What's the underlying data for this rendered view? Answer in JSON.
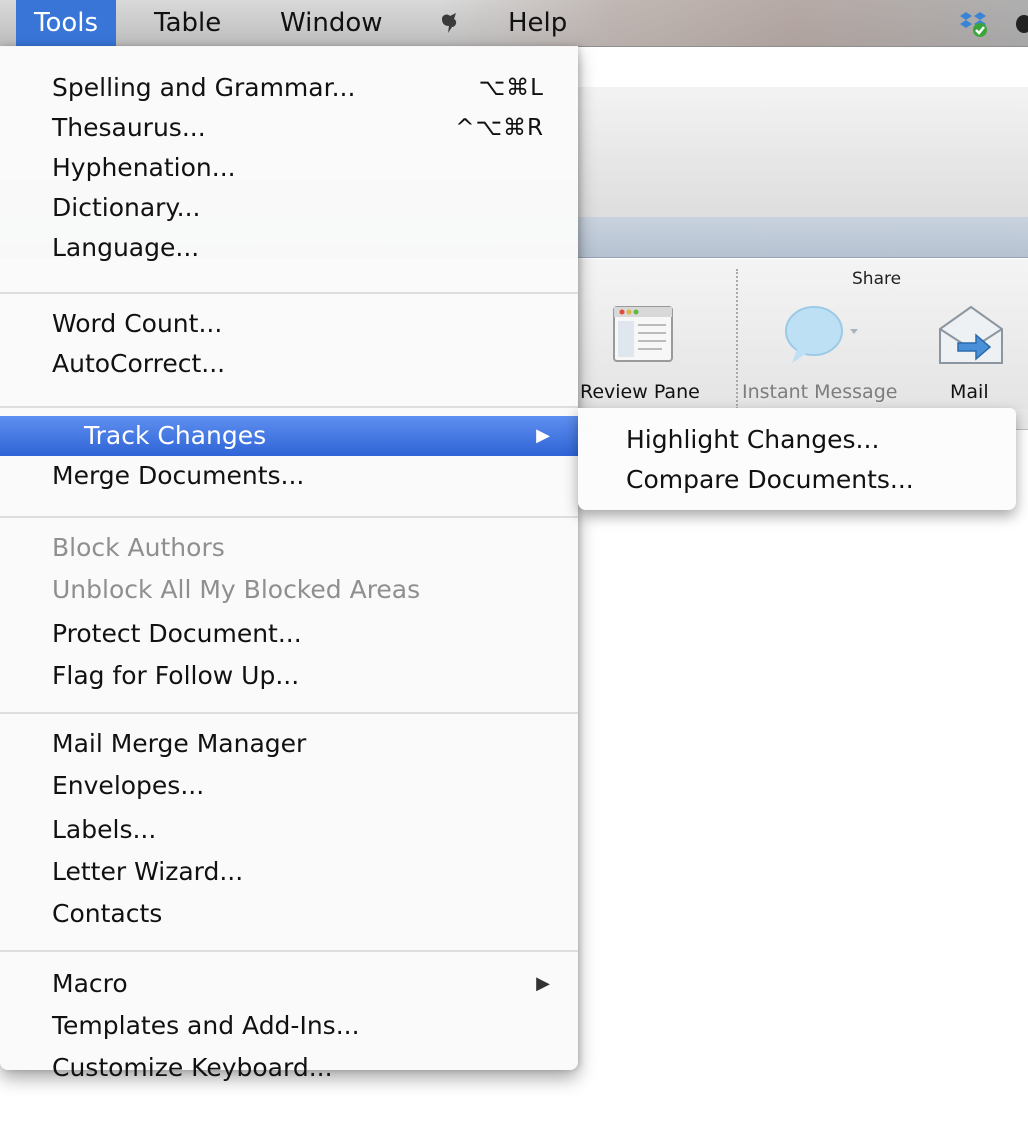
{
  "menubar": {
    "items": [
      {
        "label": "Tools",
        "active": true
      },
      {
        "label": "Table"
      },
      {
        "label": "Window"
      },
      {
        "label": "Help"
      }
    ]
  },
  "ribbon": {
    "group_share": "Share",
    "buttons": {
      "review_pane": "Review Pane",
      "instant_message": "Instant Message",
      "mail": "Mail"
    }
  },
  "tools_menu": {
    "groups": [
      [
        {
          "label": "Spelling and Grammar...",
          "shortcut": "⌥⌘L"
        },
        {
          "label": "Thesaurus...",
          "shortcut": "^⌥⌘R"
        },
        {
          "label": "Hyphenation..."
        },
        {
          "label": "Dictionary..."
        },
        {
          "label": "Language..."
        }
      ],
      [
        {
          "label": "Word Count..."
        },
        {
          "label": "AutoCorrect..."
        }
      ],
      [
        {
          "label": "Track Changes",
          "submenu": true,
          "highlighted": true
        },
        {
          "label": "Merge Documents..."
        }
      ],
      [
        {
          "label": "Block Authors",
          "disabled": true
        },
        {
          "label": "Unblock All My Blocked Areas",
          "disabled": true
        },
        {
          "label": "Protect Document..."
        },
        {
          "label": "Flag for Follow Up..."
        }
      ],
      [
        {
          "label": "Mail Merge Manager"
        },
        {
          "label": "Envelopes..."
        },
        {
          "label": "Labels..."
        },
        {
          "label": "Letter Wizard..."
        },
        {
          "label": "Contacts"
        }
      ],
      [
        {
          "label": "Macro",
          "submenu": true
        },
        {
          "label": "Templates and Add-Ins..."
        },
        {
          "label": "Customize Keyboard..."
        }
      ]
    ]
  },
  "track_changes_submenu": {
    "items": [
      "Highlight Changes...",
      "Compare Documents..."
    ]
  },
  "colors": {
    "highlight": "#3875d7",
    "disabled_text": "#8f8f8f"
  }
}
